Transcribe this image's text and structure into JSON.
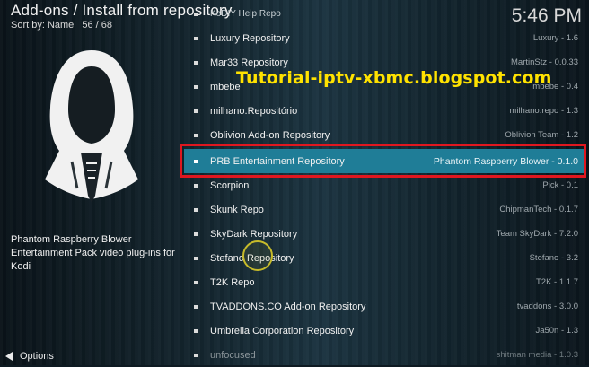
{
  "header": {
    "title": "Add-ons / Install from repository",
    "sort_label": "Sort by: Name",
    "position": "56 / 68",
    "clock": "5:46 PM"
  },
  "left_panel": {
    "description": "Phantom Raspberry Blower Entertainment Pack video plug-ins for Kodi",
    "options_label": "Options"
  },
  "watermark": "Tutorial-iptv-xbmc.blogspot.com",
  "list": [
    {
      "name": "KoDIY Help Repo",
      "meta": ""
    },
    {
      "name": "Luxury Repository",
      "meta": "Luxury - 1.6"
    },
    {
      "name": "Mar33 Repository",
      "meta": "MartinStz - 0.0.33"
    },
    {
      "name": "mbebe",
      "meta": "mbebe - 0.4"
    },
    {
      "name": "milhano.Repositório",
      "meta": "milhano.repo - 1.3"
    },
    {
      "name": "Oblivion Add-on Repository",
      "meta": "Oblivion Team - 1.2"
    },
    {
      "name": "PRB Entertainment Repository",
      "meta": "Phantom Raspberry Blower - 0.1.0"
    },
    {
      "name": "Scorpion",
      "meta": "Pick - 0.1"
    },
    {
      "name": "Skunk Repo",
      "meta": "ChipmanTech - 0.1.7"
    },
    {
      "name": "SkyDark Repository",
      "meta": "Team SkyDark - 7.2.0"
    },
    {
      "name": "Stefano Repository",
      "meta": "Stefano - 3.2"
    },
    {
      "name": "T2K Repo",
      "meta": "T2K - 1.1.7"
    },
    {
      "name": "TVADDONS.CO Add-on Repository",
      "meta": "tvaddons - 3.0.0"
    },
    {
      "name": "Umbrella Corporation Repository",
      "meta": "Ja50n - 1.3"
    },
    {
      "name": "unfocused",
      "meta": "shitman media - 1.0.3"
    }
  ]
}
